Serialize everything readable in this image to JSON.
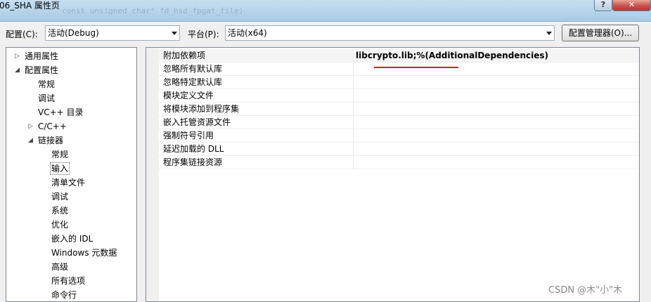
{
  "window": {
    "title": "06_SHA 属性页",
    "ghost_text": "const unsigned char* fd_hsd_fpgat_file)",
    "help_label": "?",
    "close_label": "✕"
  },
  "config": {
    "config_label": "配置(C):",
    "config_value": "活动(Debug)",
    "platform_label": "平台(P):",
    "platform_value": "活动(x64)",
    "manager_button": "配置管理器(O)..."
  },
  "tree": {
    "items": [
      {
        "label": "通用属性",
        "expander": "▷"
      },
      {
        "label": "配置属性",
        "expander": "◢"
      },
      {
        "label": "常规"
      },
      {
        "label": "调试"
      },
      {
        "label": "VC++ 目录"
      },
      {
        "label": "C/C++",
        "expander": "▷"
      },
      {
        "label": "链接器",
        "expander": "◢"
      },
      {
        "label": "常规"
      },
      {
        "label": "输入",
        "selected": true
      },
      {
        "label": "清单文件"
      },
      {
        "label": "调试"
      },
      {
        "label": "系统"
      },
      {
        "label": "优化"
      },
      {
        "label": "嵌入的 IDL"
      },
      {
        "label": "Windows 元数据"
      },
      {
        "label": "高级"
      },
      {
        "label": "所有选项"
      },
      {
        "label": "命令行"
      }
    ]
  },
  "properties": [
    {
      "name": "附加依赖项",
      "value": "libcrypto.lib;%(AdditionalDependencies)"
    },
    {
      "name": "忽略所有默认库",
      "value": ""
    },
    {
      "name": "忽略特定默认库",
      "value": ""
    },
    {
      "name": "模块定义文件",
      "value": ""
    },
    {
      "name": "将模块添加到程序集",
      "value": ""
    },
    {
      "name": "嵌入托管资源文件",
      "value": ""
    },
    {
      "name": "强制符号引用",
      "value": ""
    },
    {
      "name": "延迟加载的 DLL",
      "value": ""
    },
    {
      "name": "程序集链接资源",
      "value": ""
    }
  ],
  "watermark": "CSDN @木\"小\"木",
  "colors": {
    "annotation_underline": "#e0141c"
  }
}
